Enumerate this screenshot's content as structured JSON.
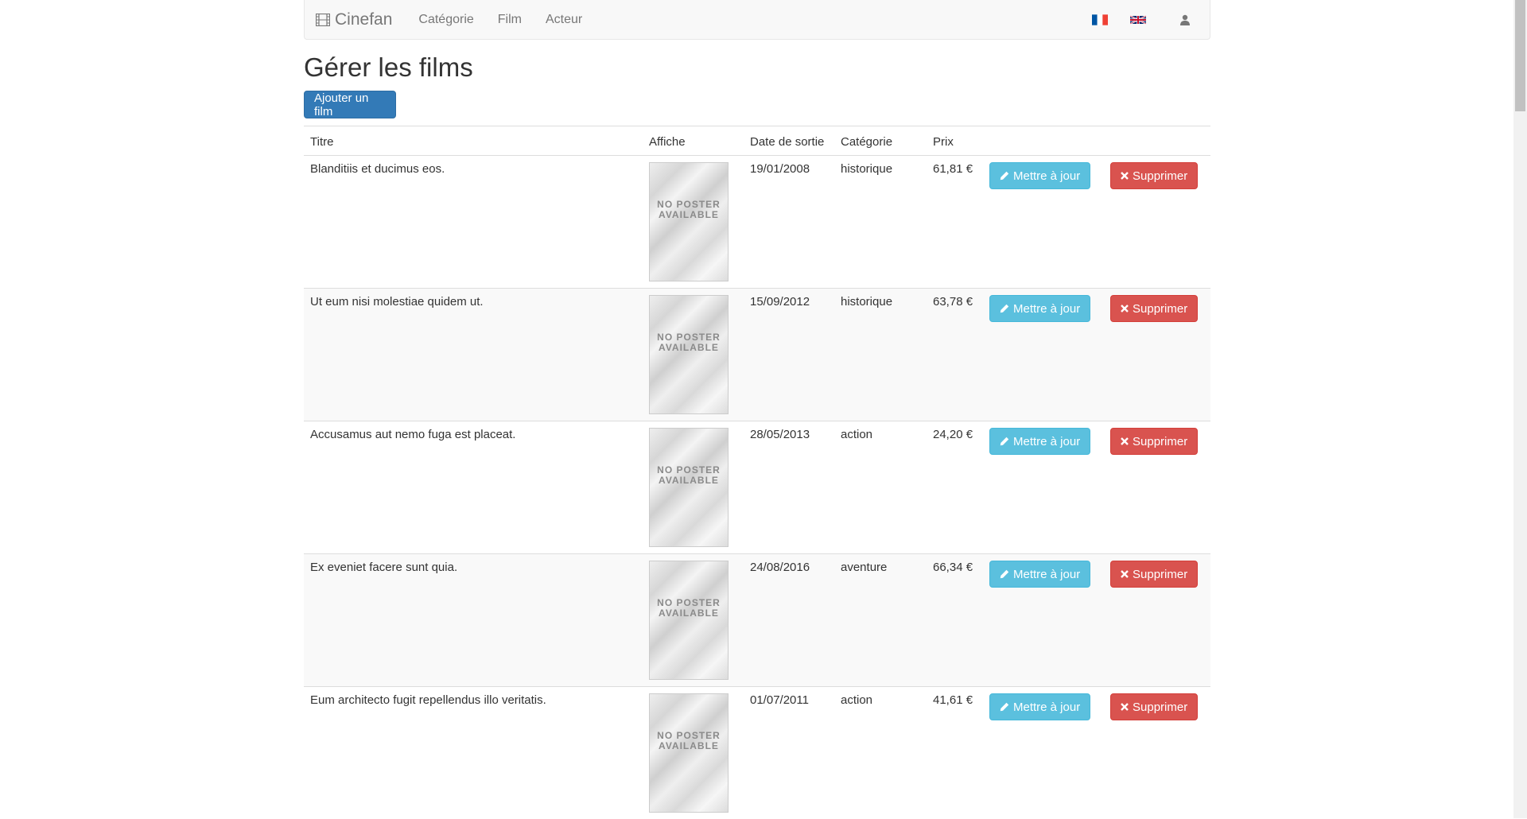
{
  "navbar": {
    "brand": "Cinefan",
    "brand_icon": "film-icon",
    "links": [
      "Catégorie",
      "Film",
      "Acteur"
    ],
    "flags": [
      "fr-flag-icon",
      "uk-flag-icon"
    ],
    "user_icon": "user-icon"
  },
  "page": {
    "title": "Gérer les films",
    "add_button": "Ajouter un film"
  },
  "table": {
    "headers": [
      "Titre",
      "Affiche",
      "Date de sortie",
      "Catégorie",
      "Prix"
    ],
    "poster_text_1": "NO POSTER",
    "poster_text_2": "AVAILABLE",
    "update_label": "Mettre à jour",
    "delete_label": "Supprimer",
    "rows": [
      {
        "title": "Blanditiis et ducimus eos.",
        "date": "19/01/2008",
        "category": "historique",
        "price": "61,81 €"
      },
      {
        "title": "Ut eum nisi molestiae quidem ut.",
        "date": "15/09/2012",
        "category": "historique",
        "price": "63,78 €"
      },
      {
        "title": "Accusamus aut nemo fuga est placeat.",
        "date": "28/05/2013",
        "category": "action",
        "price": "24,20 €"
      },
      {
        "title": "Ex eveniet facere sunt quia.",
        "date": "24/08/2016",
        "category": "aventure",
        "price": "66,34 €"
      },
      {
        "title": "Eum architecto fugit repellendus illo veritatis.",
        "date": "01/07/2011",
        "category": "action",
        "price": "41,61 €"
      }
    ]
  },
  "colors": {
    "primary": "#337ab7",
    "info": "#5bc0de",
    "danger": "#d9534f"
  }
}
